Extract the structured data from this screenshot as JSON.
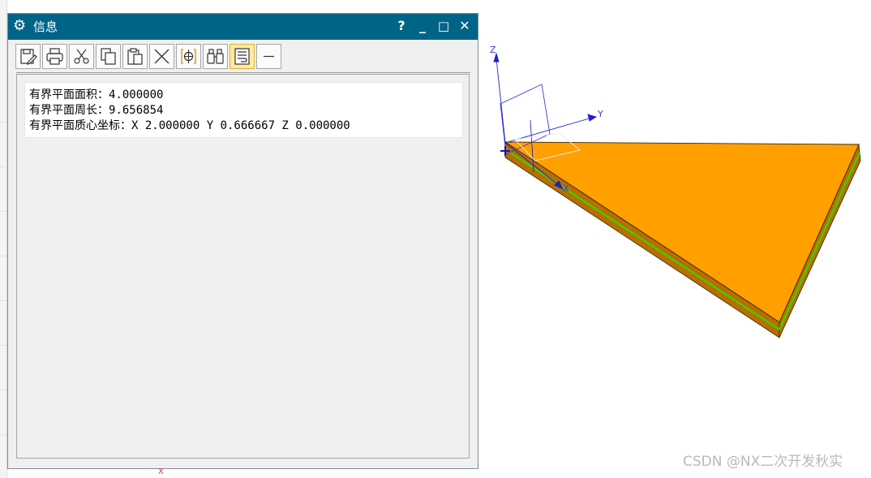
{
  "dialog": {
    "title": "信息",
    "help_glyph": "?",
    "minimize_glyph": "_",
    "maximize_glyph": "□",
    "close_glyph": "✕",
    "gear_glyph": "⚙"
  },
  "toolbar": {
    "items": [
      {
        "name": "save-icon"
      },
      {
        "name": "print-icon"
      },
      {
        "name": "cut-icon"
      },
      {
        "name": "copy-icon"
      },
      {
        "name": "paste-icon"
      },
      {
        "name": "delete-icon"
      },
      {
        "name": "center-icon"
      },
      {
        "name": "find-icon"
      },
      {
        "name": "wrap-icon",
        "active": true
      },
      {
        "name": "minimize-icon"
      }
    ]
  },
  "info": {
    "lines": [
      "有界平面面积：4.000000",
      "有界平面周长：9.656854",
      "有界平面质心坐标：X 2.000000 Y 0.666667 Z 0.000000"
    ]
  },
  "viewport": {
    "axis_z": "Z",
    "axis_y": "Y",
    "axis_x": "X",
    "colors": {
      "body_top": "#ffa000",
      "body_side": "#b86e00",
      "edge_highlight": "#3cd400",
      "axis": "#2020c8"
    }
  },
  "watermark": "CSDN @NX二次开发秋实",
  "bottom_marker": "X"
}
